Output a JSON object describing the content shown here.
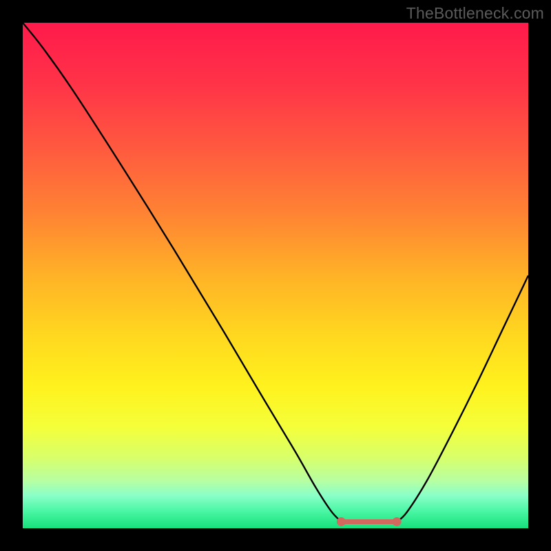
{
  "watermark": "TheBottleneck.com",
  "colors": {
    "frame": "#000000",
    "curve": "#000000",
    "marker": "#d1695e",
    "gradient_stops": [
      {
        "offset": 0.0,
        "color": "#ff1a4b"
      },
      {
        "offset": 0.12,
        "color": "#ff3348"
      },
      {
        "offset": 0.25,
        "color": "#ff5a3f"
      },
      {
        "offset": 0.38,
        "color": "#ff8433"
      },
      {
        "offset": 0.5,
        "color": "#ffb227"
      },
      {
        "offset": 0.62,
        "color": "#ffd81f"
      },
      {
        "offset": 0.72,
        "color": "#fff21e"
      },
      {
        "offset": 0.8,
        "color": "#f4ff3a"
      },
      {
        "offset": 0.86,
        "color": "#d8ff6a"
      },
      {
        "offset": 0.905,
        "color": "#b8ffa0"
      },
      {
        "offset": 0.935,
        "color": "#8affc8"
      },
      {
        "offset": 0.965,
        "color": "#4cf7a6"
      },
      {
        "offset": 1.0,
        "color": "#17e07b"
      }
    ]
  },
  "chart_data": {
    "type": "line",
    "title": "",
    "xlabel": "",
    "ylabel": "",
    "xlim": [
      0,
      100
    ],
    "ylim": [
      0,
      100
    ],
    "left_branch": [
      {
        "x": 0,
        "y": 100
      },
      {
        "x": 4,
        "y": 95
      },
      {
        "x": 10,
        "y": 86.5
      },
      {
        "x": 20,
        "y": 71
      },
      {
        "x": 30,
        "y": 55
      },
      {
        "x": 40,
        "y": 38.5
      },
      {
        "x": 48,
        "y": 25
      },
      {
        "x": 54,
        "y": 15
      },
      {
        "x": 58,
        "y": 8
      },
      {
        "x": 61,
        "y": 3.4
      },
      {
        "x": 63,
        "y": 1.3
      }
    ],
    "flat_segment": [
      {
        "x": 63,
        "y": 1.3
      },
      {
        "x": 74,
        "y": 1.3
      }
    ],
    "right_branch": [
      {
        "x": 74,
        "y": 1.3
      },
      {
        "x": 76,
        "y": 3.2
      },
      {
        "x": 80,
        "y": 9.5
      },
      {
        "x": 85,
        "y": 19
      },
      {
        "x": 90,
        "y": 29
      },
      {
        "x": 95,
        "y": 39.5
      },
      {
        "x": 100,
        "y": 50
      }
    ],
    "marker_endpoints": [
      {
        "x": 63,
        "y": 1.3
      },
      {
        "x": 74,
        "y": 1.3
      }
    ]
  }
}
